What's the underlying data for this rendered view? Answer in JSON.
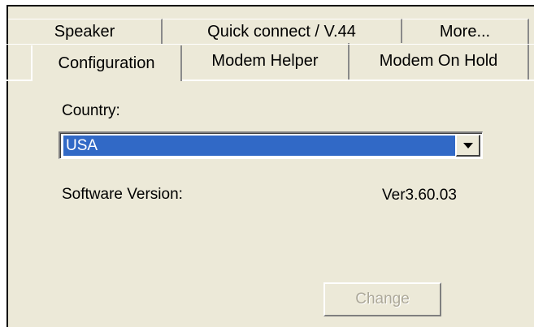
{
  "tabs": {
    "back_row": [
      "Speaker",
      "Quick connect / V.44",
      "More..."
    ],
    "front_row": [
      "Configuration",
      "Modem Helper",
      "Modem On Hold"
    ],
    "selected": "Configuration"
  },
  "configuration": {
    "country_label": "Country:",
    "country_value": "USA",
    "software_version_label": "Software Version:",
    "software_version_value": "Ver3.60.03",
    "change_button": "Change"
  },
  "colors": {
    "window_bg": "#ece9d8",
    "selection": "#3169c6",
    "disabled_text": "#aca899"
  }
}
